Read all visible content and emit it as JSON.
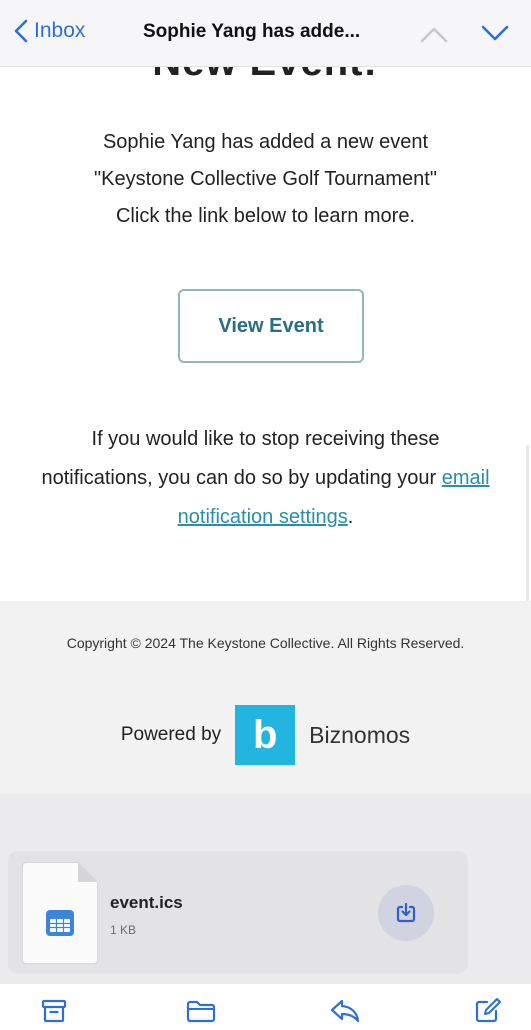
{
  "nav": {
    "back_label": "Inbox",
    "subject": "Sophie Yang has adde...",
    "icons": [
      "chevron-left-icon",
      "chevron-up-icon",
      "chevron-down-icon"
    ],
    "accent_color": "#2e6fd6"
  },
  "email": {
    "heading_partial": "New Event!",
    "body_lines": [
      "Sophie Yang has added a new event",
      "\"Keystone Collective Golf Tournament\"",
      "Click the link below to learn more."
    ],
    "button_label": "View Event",
    "unsubscribe_before": "If you would like to stop receiving these notifications, you can do so by updating your ",
    "unsubscribe_link": "email notification settings",
    "unsubscribe_after": ".",
    "link_color": "#2a8ea8"
  },
  "footer": {
    "copyright": "Copyright © 2024 The Keystone Collective. All Rights Reserved.",
    "powered_by_label": "Powered by",
    "brand_letter": "b",
    "brand_name": "Biznomos",
    "brand_color": "#22b5e0"
  },
  "attachment": {
    "file_name": "event.ics",
    "file_size": "1 KB",
    "icons": [
      "calendar-file-icon",
      "save-attachment-icon"
    ]
  },
  "toolbar": {
    "icons": [
      "archive-icon",
      "folder-icon",
      "reply-icon",
      "compose-icon"
    ],
    "icon_color": "#2e6fd6"
  }
}
